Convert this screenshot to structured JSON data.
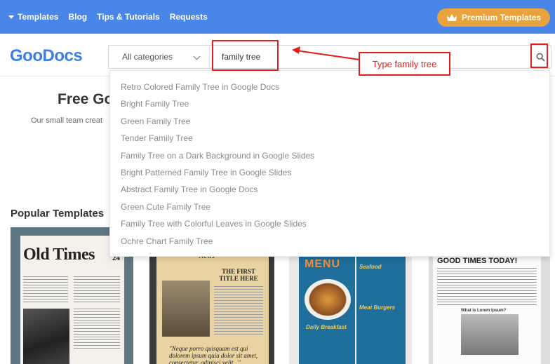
{
  "topnav": {
    "items": [
      {
        "label": "Templates"
      },
      {
        "label": "Blog"
      },
      {
        "label": "Tips & Tutorials"
      },
      {
        "label": "Requests"
      }
    ],
    "premium_label": "Premium Templates",
    "background": "#4a86e8",
    "premium_color": "#e8a33d"
  },
  "header": {
    "logo": "GooDocs",
    "category_select": "All categories",
    "search_value": "family tree",
    "search_icon": "search-icon"
  },
  "hero": {
    "title": "Free Go",
    "subtitle": "Our small team creat"
  },
  "popular": {
    "heading": "Popular Templates",
    "thumbs": [
      {
        "title": "Old Times",
        "number": "24"
      },
      {
        "title": "News",
        "headline": "THE FIRST TITLE HERE",
        "quote": "\"Neque porro quisquam est qui dolorem ipsum quia dolor sit amet, consectetur, adipisci velit...\""
      },
      {
        "title": "MENU",
        "labels": [
          "Seafood",
          "Meat Burgers",
          "Daily Breakfast"
        ]
      },
      {
        "title": "GOOD TIMES TODAY!",
        "caption": "What is Lorem Ipsum?"
      }
    ]
  },
  "suggestions": [
    "Retro Colored Family Tree in Google Docs",
    "Bright Family Tree",
    "Green Family Tree",
    "Tender Family Tree",
    "Family Tree on a Dark Background in Google Slides",
    "Bright Patterned Family Tree in Google Slides",
    "Abstract Family Tree in Google Docs",
    "Green Cute Family Tree",
    "Family Tree with Colorful Leaves in Google Slides",
    "Ochre Chart Family Tree"
  ],
  "annotation": {
    "label": "Type family tree",
    "color": "#e02020"
  }
}
